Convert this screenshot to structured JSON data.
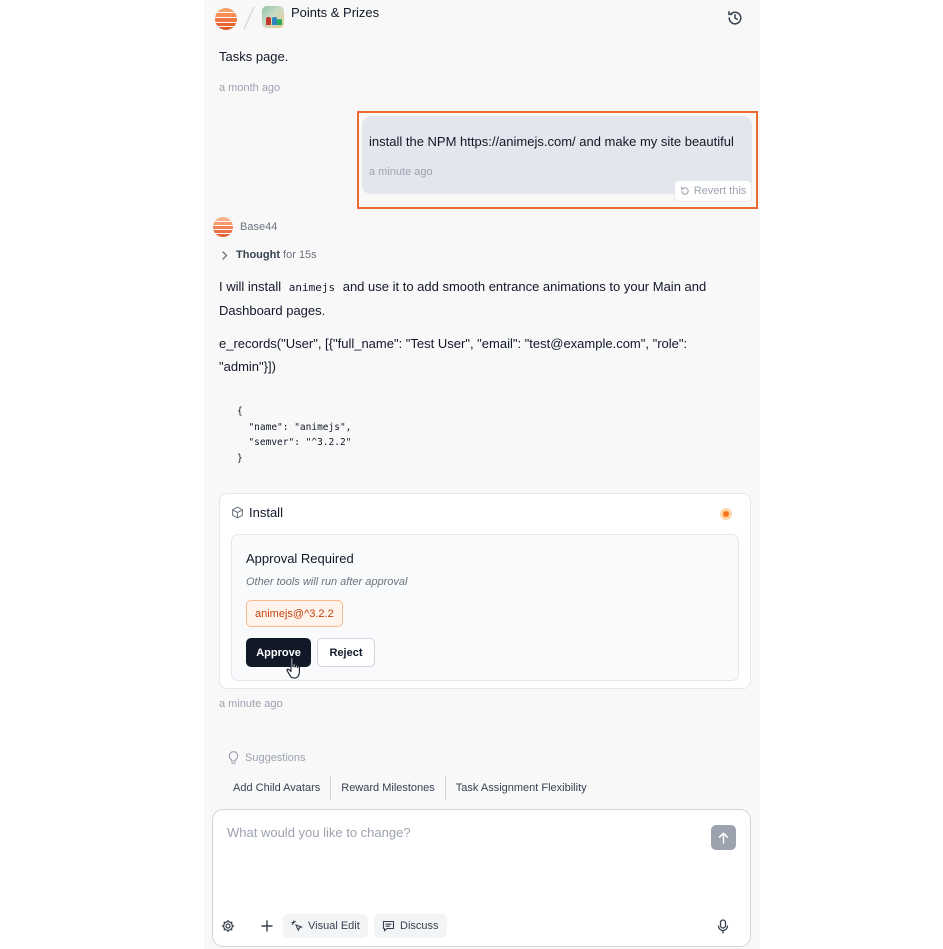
{
  "header": {
    "project_title": "Points & Prizes",
    "history_icon": "history-icon"
  },
  "messages": {
    "prev_text": "Tasks page.",
    "prev_time": "a month ago",
    "user_text": "install the NPM https://animejs.com/ and make my site beautiful",
    "user_time": "a minute ago",
    "revert_label": "Revert this",
    "assistant_name": "Base44",
    "thought_label": "Thought",
    "thought_duration": "for 15s",
    "reply_before_code": "I will install ",
    "reply_code": "animejs",
    "reply_after_code": " and use it to add smooth entrance animations to your Main and Dashboard pages.",
    "reply_line2": "e_records(\"User\", [{\"full_name\": \"Test User\", \"email\": \"test@example.com\", \"role\": \"admin\"}])",
    "code_block": "{\n  \"name\": \"animejs\",\n  \"semver\": \"^3.2.2\"\n}",
    "reply_time": "a minute ago"
  },
  "install_card": {
    "title": "Install",
    "approval_title": "Approval Required",
    "approval_sub": "Other tools will run after approval",
    "package": "animejs@^3.2.2",
    "approve_label": "Approve",
    "reject_label": "Reject",
    "status_color": "#f97316"
  },
  "suggestions": {
    "heading": "Suggestions",
    "items": [
      "Add Child Avatars",
      "Reward Milestones",
      "Task Assignment Flexibility"
    ]
  },
  "composer": {
    "placeholder": "What would you like to change?",
    "visual_edit_label": "Visual Edit",
    "discuss_label": "Discuss"
  },
  "colors": {
    "accent_orange": "#ea6a2f",
    "primary_dark": "#111827"
  }
}
